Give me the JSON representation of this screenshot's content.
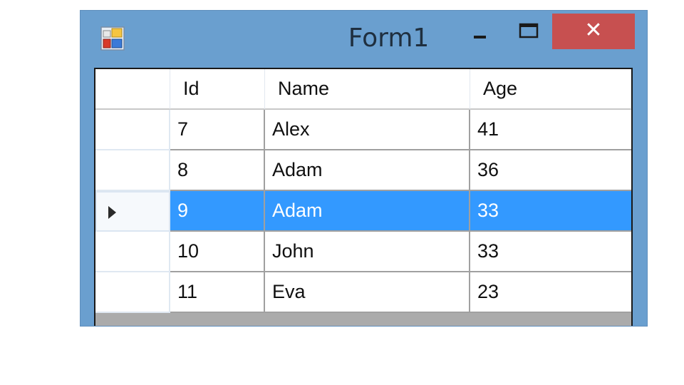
{
  "window": {
    "title": "Form1",
    "close_glyph": "✕",
    "colors": {
      "frame": "#6a9fcf",
      "close": "#c75050",
      "selection": "#3399ff"
    },
    "icons": {
      "app": "form-app-icon",
      "minimize": "minimize-icon",
      "maximize": "maximize-icon",
      "close": "close-icon"
    }
  },
  "grid": {
    "columns": [
      "Id",
      "Name",
      "Age"
    ],
    "rows": [
      {
        "id": "7",
        "name": "Alex",
        "age": "41"
      },
      {
        "id": "8",
        "name": "Adam",
        "age": "36"
      },
      {
        "id": "9",
        "name": "Adam",
        "age": "33"
      },
      {
        "id": "10",
        "name": "John",
        "age": "33"
      },
      {
        "id": "11",
        "name": "Eva",
        "age": "23"
      }
    ],
    "selected_row_index": 2,
    "current_row_icon": "current-row-arrow-icon"
  }
}
